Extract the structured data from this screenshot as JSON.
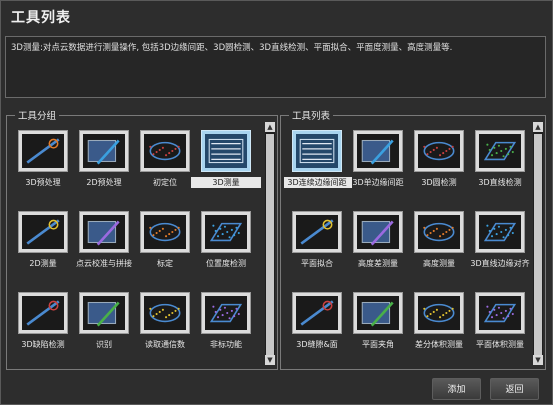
{
  "window": {
    "title": "工具列表"
  },
  "description": "3D测量:对点云数据进行测量操作, 包括3D边缘间距、3D圆检测、3D直线检测、平面拟合、平面度测量、高度测量等.",
  "left_group": {
    "title": "工具分组",
    "items": [
      {
        "label": "3D预处理",
        "icon": "wrench-cloud-icon"
      },
      {
        "label": "2D预处理",
        "icon": "image-pencil-icon"
      },
      {
        "label": "初定位",
        "icon": "match-icon"
      },
      {
        "label": "3D测量",
        "icon": "3d-measure-icon",
        "selected": true
      },
      {
        "label": "2D测量",
        "icon": "2d-measure-icon"
      },
      {
        "label": "点云校准与拼接",
        "icon": "calibrate-icon"
      },
      {
        "label": "标定",
        "icon": "image-world-icon"
      },
      {
        "label": "位置度检测",
        "icon": "crosshair-icon"
      },
      {
        "label": "3D缺陷检测",
        "icon": "defect-icon"
      },
      {
        "label": "识别",
        "icon": "ocr-code-icon"
      },
      {
        "label": "读取通信数",
        "icon": "phone-icon"
      },
      {
        "label": "非标功能",
        "icon": "gears-icon"
      }
    ]
  },
  "right_group": {
    "title": "工具列表",
    "items": [
      {
        "label": "3D连续边缘间距",
        "icon": "edge-distance-icon",
        "selected": true
      },
      {
        "label": "3D单边缘间距",
        "icon": "single-edge-icon"
      },
      {
        "label": "3D圆检测",
        "icon": "circle-detect-icon"
      },
      {
        "label": "3D直线检测",
        "icon": "line-detect-icon"
      },
      {
        "label": "平面拟合",
        "icon": "plane-fit-icon"
      },
      {
        "label": "高度差测量",
        "icon": "height-diff-icon"
      },
      {
        "label": "高度测量",
        "icon": "height-measure-icon"
      },
      {
        "label": "3D直线边缘对齐",
        "icon": "line-align-icon"
      },
      {
        "label": "3D缝隙&面",
        "icon": "gap-icon"
      },
      {
        "label": "平面夹角",
        "icon": "plane-angle-icon"
      },
      {
        "label": "差分体积测量",
        "icon": "diff-volume-icon"
      },
      {
        "label": "平面体积测量",
        "icon": "plane-volume-icon"
      }
    ]
  },
  "buttons": {
    "add": "添加",
    "back": "返回"
  }
}
